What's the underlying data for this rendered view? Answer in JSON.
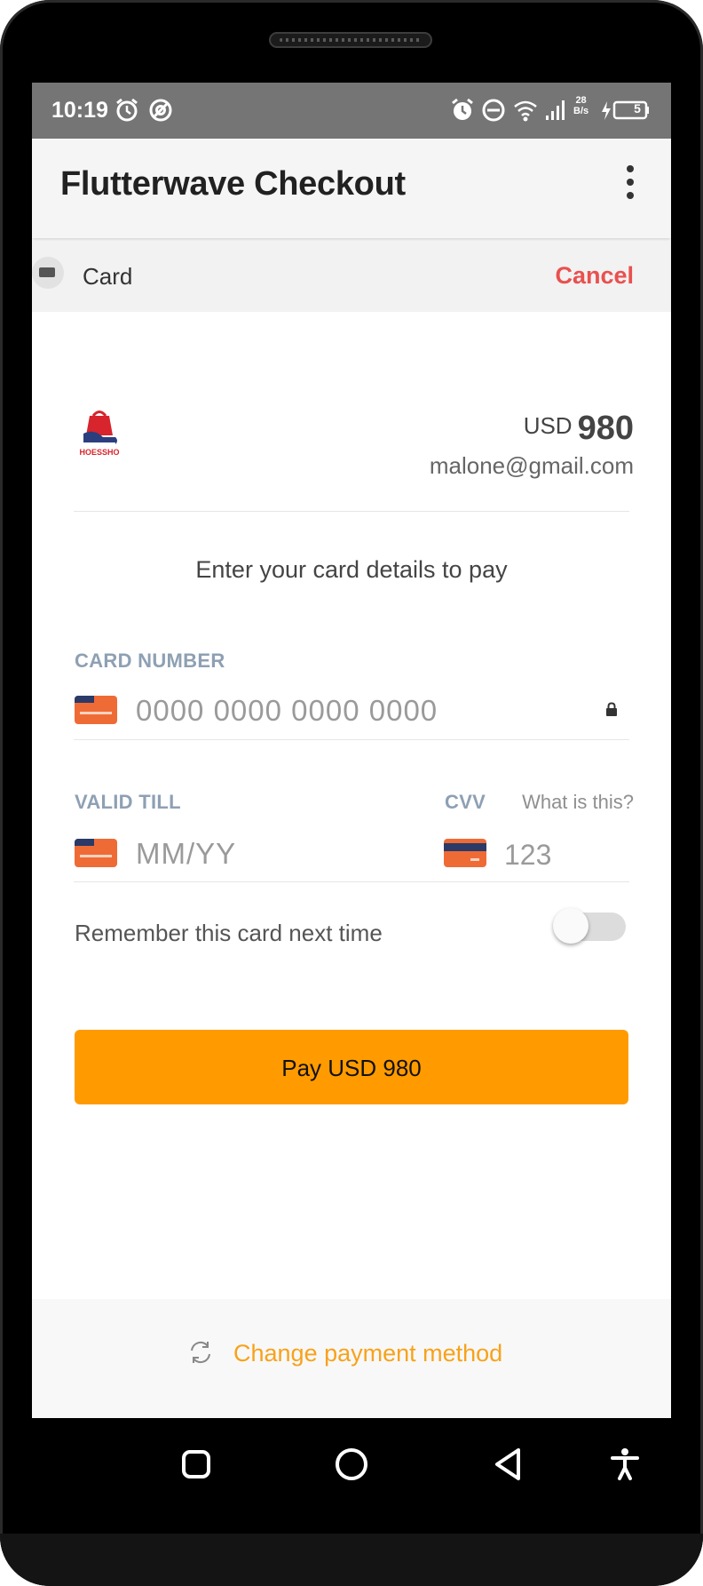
{
  "status_bar": {
    "time": "10:19",
    "net_speed_value": "28",
    "net_speed_unit": "B/s",
    "battery": "5"
  },
  "app_bar": {
    "title": "Flutterwave Checkout",
    "menu_icon": "more-vert-icon"
  },
  "payment_header": {
    "method_label": "Card",
    "cancel_label": "Cancel"
  },
  "merchant": {
    "logo_text": "HOESSHO",
    "currency": "USD",
    "amount": "980",
    "email": "malone@gmail.com"
  },
  "form": {
    "prompt": "Enter your card details to pay",
    "card_number": {
      "label": "CARD NUMBER",
      "placeholder": "0000 0000 0000 0000",
      "value": ""
    },
    "valid_till": {
      "label": "VALID TILL",
      "placeholder": "MM/YY",
      "value": ""
    },
    "cvv": {
      "label": "CVV",
      "help_link": "What is this?",
      "placeholder": "123",
      "value": ""
    },
    "remember": {
      "label": "Remember this card next time",
      "on": false
    },
    "pay_button": "Pay USD 980"
  },
  "footer": {
    "change_method": "Change payment method"
  },
  "colors": {
    "accent": "#ff9b00",
    "cancel": "#e8514f",
    "link": "#f7a21b",
    "label": "#8ea0b3",
    "card_icon": "#ef6b36"
  }
}
